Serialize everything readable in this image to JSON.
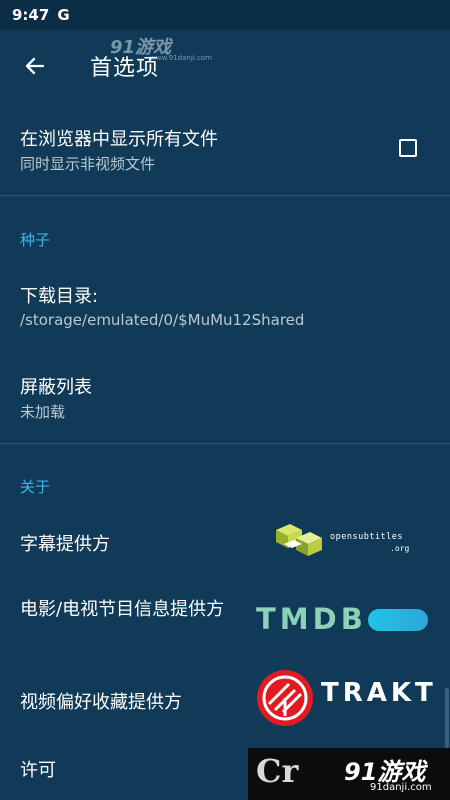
{
  "status_bar": {
    "time": "9:47",
    "google_badge": "G"
  },
  "app_bar": {
    "title": "首选项",
    "back_icon": "arrow-left-icon"
  },
  "watermark_top": {
    "main": "91游戏",
    "sub": "www.91danji.com"
  },
  "settings": {
    "show_all_files": {
      "title": "在浏览器中显示所有文件",
      "subtitle": "同时显示非视频文件",
      "checked": false
    },
    "torrent_section": {
      "header": "种子",
      "download_dir": {
        "title": "下载目录:",
        "value": "/storage/emulated/0/$MuMu12Shared"
      },
      "blocklist": {
        "title": "屏蔽列表",
        "value": "未加载"
      }
    },
    "about_section": {
      "header": "关于",
      "subtitle_provider": {
        "title": "字幕提供方",
        "logo_name": "opensubtitles",
        "logo_text": "opensubtitles",
        "logo_suffix": ".org"
      },
      "metadata_provider": {
        "title": "电影/电视节目信息提供方",
        "logo_text": "TMDB"
      },
      "favorites_provider": {
        "title": "视频偏好收藏提供方",
        "logo_text": "TRAKT"
      },
      "license": {
        "title": "许可"
      }
    }
  },
  "watermark_bottom": {
    "left": "Cr",
    "main": "91游戏",
    "sub": "91danji.com"
  },
  "colors": {
    "background": "#103a57",
    "accent": "#36b6ea",
    "status_bar": "#0b2d45",
    "tmdb_green": "#8cd2b9",
    "trakt_red": "#e11b22"
  }
}
